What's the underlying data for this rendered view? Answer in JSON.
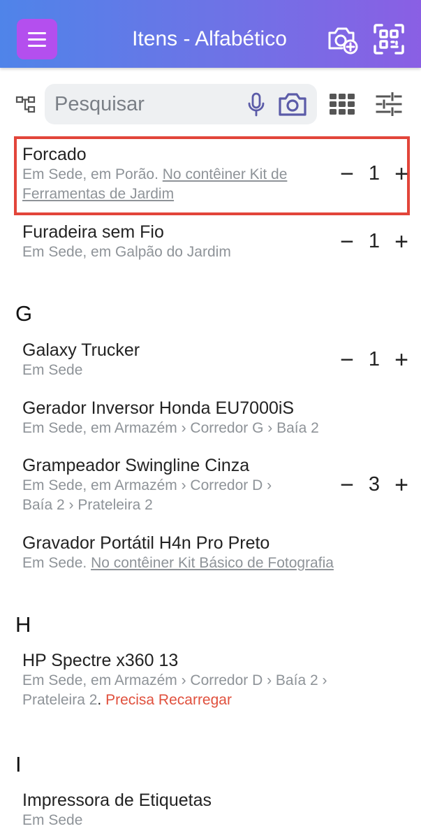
{
  "header": {
    "title": "Itens - Alfabético",
    "menu_icon": "hamburger-menu-icon",
    "add_photo_icon": "camera-add-icon",
    "scan_icon": "qr-scan-icon",
    "gradient_start": "#4f84e9",
    "gradient_end": "#8a5fe4",
    "menu_color": "#b44fee"
  },
  "search": {
    "placeholder": "Pesquisar",
    "mic_icon": "microphone-icon",
    "camera_icon": "camera-icon"
  },
  "toolbar": {
    "tree_icon": "hierarchy-icon",
    "grid_icon": "grid-view-icon",
    "filter_icon": "sliders-filter-icon"
  },
  "sections": [
    {
      "letter": "G"
    },
    {
      "letter": "H"
    },
    {
      "letter": "I"
    }
  ],
  "items": [
    {
      "name": "Forcado",
      "loc": "Em Sede, em Porão. ",
      "link": "No contêiner Kit de Ferramentas de Jardim",
      "qty": "1",
      "selected": true
    },
    {
      "name": "Furadeira sem Fio",
      "loc": "Em Sede, em Galpão do Jardim",
      "qty": "1"
    },
    {
      "name": "Galaxy Trucker",
      "loc": "Em Sede",
      "qty": "1"
    },
    {
      "name": "Gerador Inversor Honda EU7000iS",
      "loc": "Em Sede, em Armazém › Corredor G › Baía 2"
    },
    {
      "name": "Grampeador Swingline Cinza",
      "loc": "Em Sede, em Armazém › Corredor D › Baía 2 › Prateleira 2",
      "qty": "3"
    },
    {
      "name": "Gravador Portátil H4n Pro Preto",
      "loc": "Em Sede. ",
      "link": "No contêiner Kit Básico de Fotografia"
    },
    {
      "name": "HP Spectre x360 13",
      "loc": "Em Sede, em Armazém › Corredor D › Baía 2 › Prateleira 2",
      "loc_end": ". ",
      "alert": "Precisa Recarregar",
      "alert_color": "#e0503d"
    },
    {
      "name": "Impressora de Etiquetas",
      "loc": "Em Sede"
    }
  ],
  "qty_controls": {
    "minus": "−",
    "plus": "+"
  },
  "highlight_color": "#e2453a"
}
